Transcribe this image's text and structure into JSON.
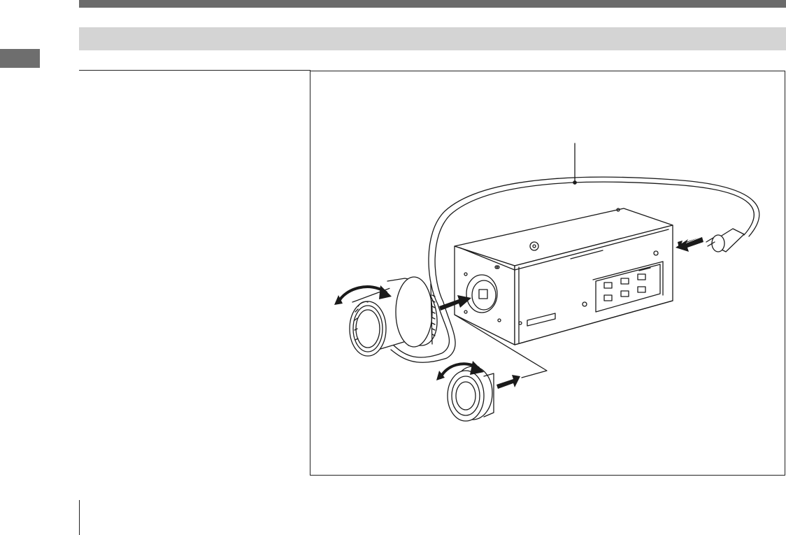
{
  "page": {
    "colors": {
      "header_bar": "#6b6b6b",
      "section_band": "#d4d4d4",
      "side_tab": "#6e6e6e",
      "line_art": "#1a1a1a"
    }
  },
  "figure": {
    "icons": [
      "camera-body-icon",
      "lens-icon",
      "adaptor-ring-icon",
      "cable-icon",
      "connector-plug-icon",
      "rotate-arrow-icon",
      "insert-arrow-icon"
    ]
  }
}
